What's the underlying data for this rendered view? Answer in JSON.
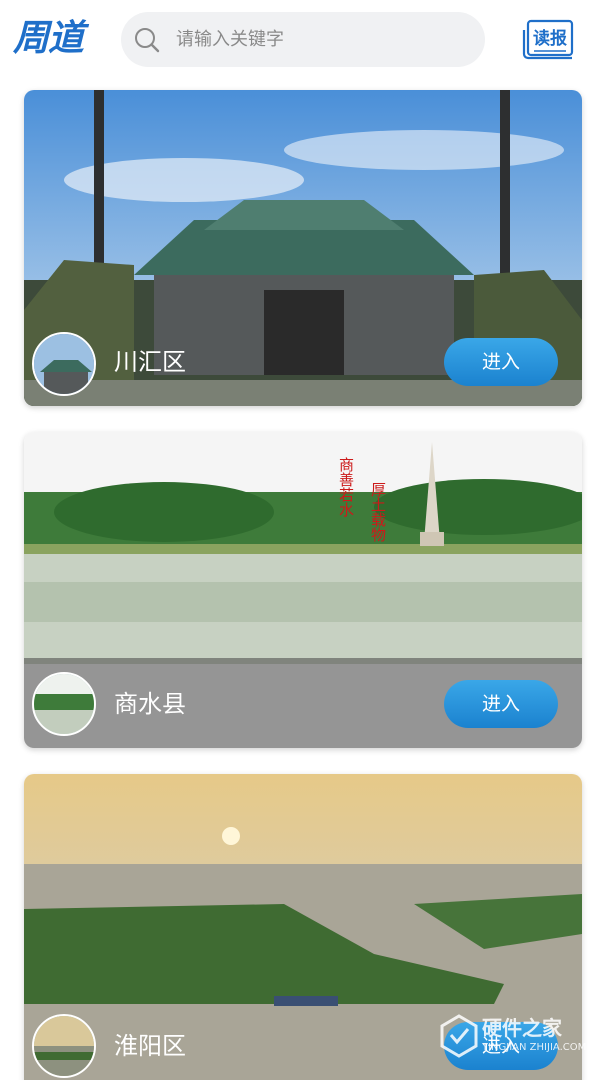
{
  "header": {
    "logo_text": "周道",
    "search_placeholder": "请输入关键字",
    "news_label": "读报",
    "accent": "#1f6fc9"
  },
  "cards": [
    {
      "name": "川汇区",
      "enter_label": "进入",
      "scene": "temple"
    },
    {
      "name": "商水县",
      "enter_label": "进入",
      "scene": "lake-pagoda",
      "sign_left": "商善若水",
      "sign_right": "厚土载物"
    },
    {
      "name": "淮阳区",
      "enter_label": "进入",
      "scene": "sunset-lake"
    }
  ],
  "watermark": {
    "cn": "硬件之家",
    "en": "YINGJIAN ZHIJIA.COM"
  },
  "colors": {
    "button": "#2590dc",
    "bar": "#464646"
  }
}
